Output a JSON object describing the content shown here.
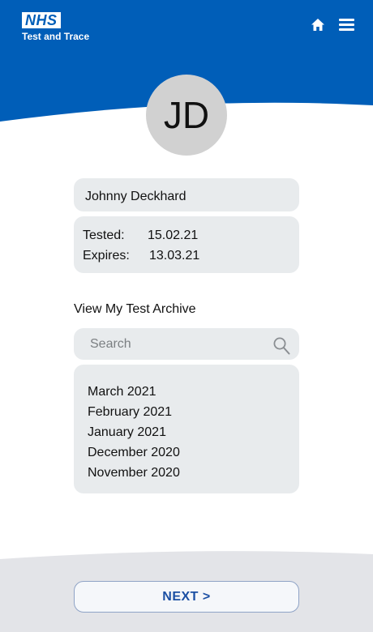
{
  "header": {
    "logo_text": "NHS",
    "logo_subtitle": "Test and Trace",
    "home_icon": "home-icon",
    "menu_icon": "menu-icon"
  },
  "profile": {
    "initials": "JD",
    "name": "Johnny Deckhard",
    "tested_label": "Tested:",
    "tested_date": "15.02.21",
    "expires_label": "Expires:",
    "expires_date": "13.03.21"
  },
  "archive": {
    "title": "View My Test Archive",
    "search_placeholder": "Search",
    "items": [
      "March 2021",
      "February 2021",
      "January 2021",
      "December 2020",
      "November 2020"
    ]
  },
  "footer": {
    "next_label": "NEXT >"
  },
  "colors": {
    "brand_blue": "#005eb8",
    "card_grey": "#e8ebed",
    "footer_grey": "#e3e4e8"
  }
}
